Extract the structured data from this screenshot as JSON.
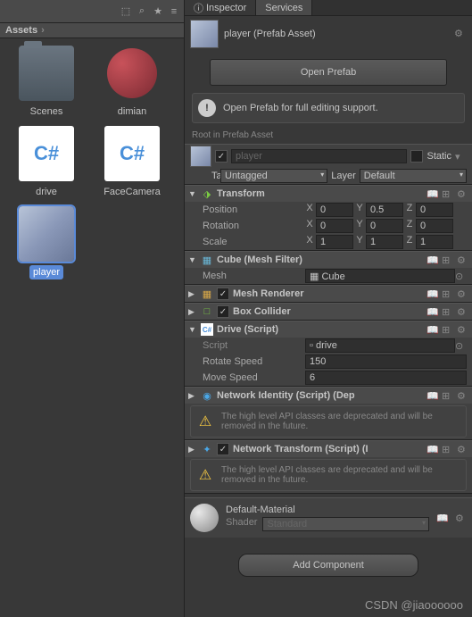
{
  "assets": {
    "header": "Assets",
    "items": [
      {
        "label": "Scenes",
        "type": "folder"
      },
      {
        "label": "dimian",
        "type": "sphere"
      },
      {
        "label": "drive",
        "type": "script",
        "glyph": "C#"
      },
      {
        "label": "FaceCamera",
        "type": "script",
        "glyph": "C#"
      },
      {
        "label": "player",
        "type": "cube",
        "selected": true
      }
    ]
  },
  "tabs": {
    "inspector": "Inspector",
    "services": "Services"
  },
  "header": {
    "name": "player (Prefab Asset)"
  },
  "openPrefab": {
    "btn": "Open Prefab",
    "hint": "Open Prefab for full editing support."
  },
  "rootLabel": "Root in Prefab Asset",
  "obj": {
    "name": "player",
    "static": "Static",
    "tagLbl": "Tag",
    "tag": "Untagged",
    "layerLbl": "Layer",
    "layer": "Default"
  },
  "transform": {
    "title": "Transform",
    "pos": "Position",
    "rot": "Rotation",
    "scl": "Scale",
    "px": "0",
    "py": "0.5",
    "pz": "0",
    "rx": "0",
    "ry": "0",
    "rz": "0",
    "sx": "1",
    "sy": "1",
    "sz": "1"
  },
  "meshFilter": {
    "title": "Cube (Mesh Filter)",
    "meshLbl": "Mesh",
    "mesh": "Cube"
  },
  "meshRenderer": {
    "title": "Mesh Renderer"
  },
  "boxCollider": {
    "title": "Box Collider"
  },
  "drive": {
    "title": "Drive (Script)",
    "scriptLbl": "Script",
    "script": "drive",
    "rsLbl": "Rotate Speed",
    "rs": "150",
    "msLbl": "Move Speed",
    "ms": "6"
  },
  "netId": {
    "title": "Network Identity (Script) (Dep",
    "warn": "The high level API classes are deprecated and will be removed in the future."
  },
  "netTr": {
    "title": "Network Transform (Script) (I",
    "warn": "The high level API classes are deprecated and will be removed in the future."
  },
  "mat": {
    "name": "Default-Material",
    "shaderLbl": "Shader",
    "shader": "Standard"
  },
  "addComp": "Add Component",
  "watermark": "CSDN @jiaoooooo"
}
